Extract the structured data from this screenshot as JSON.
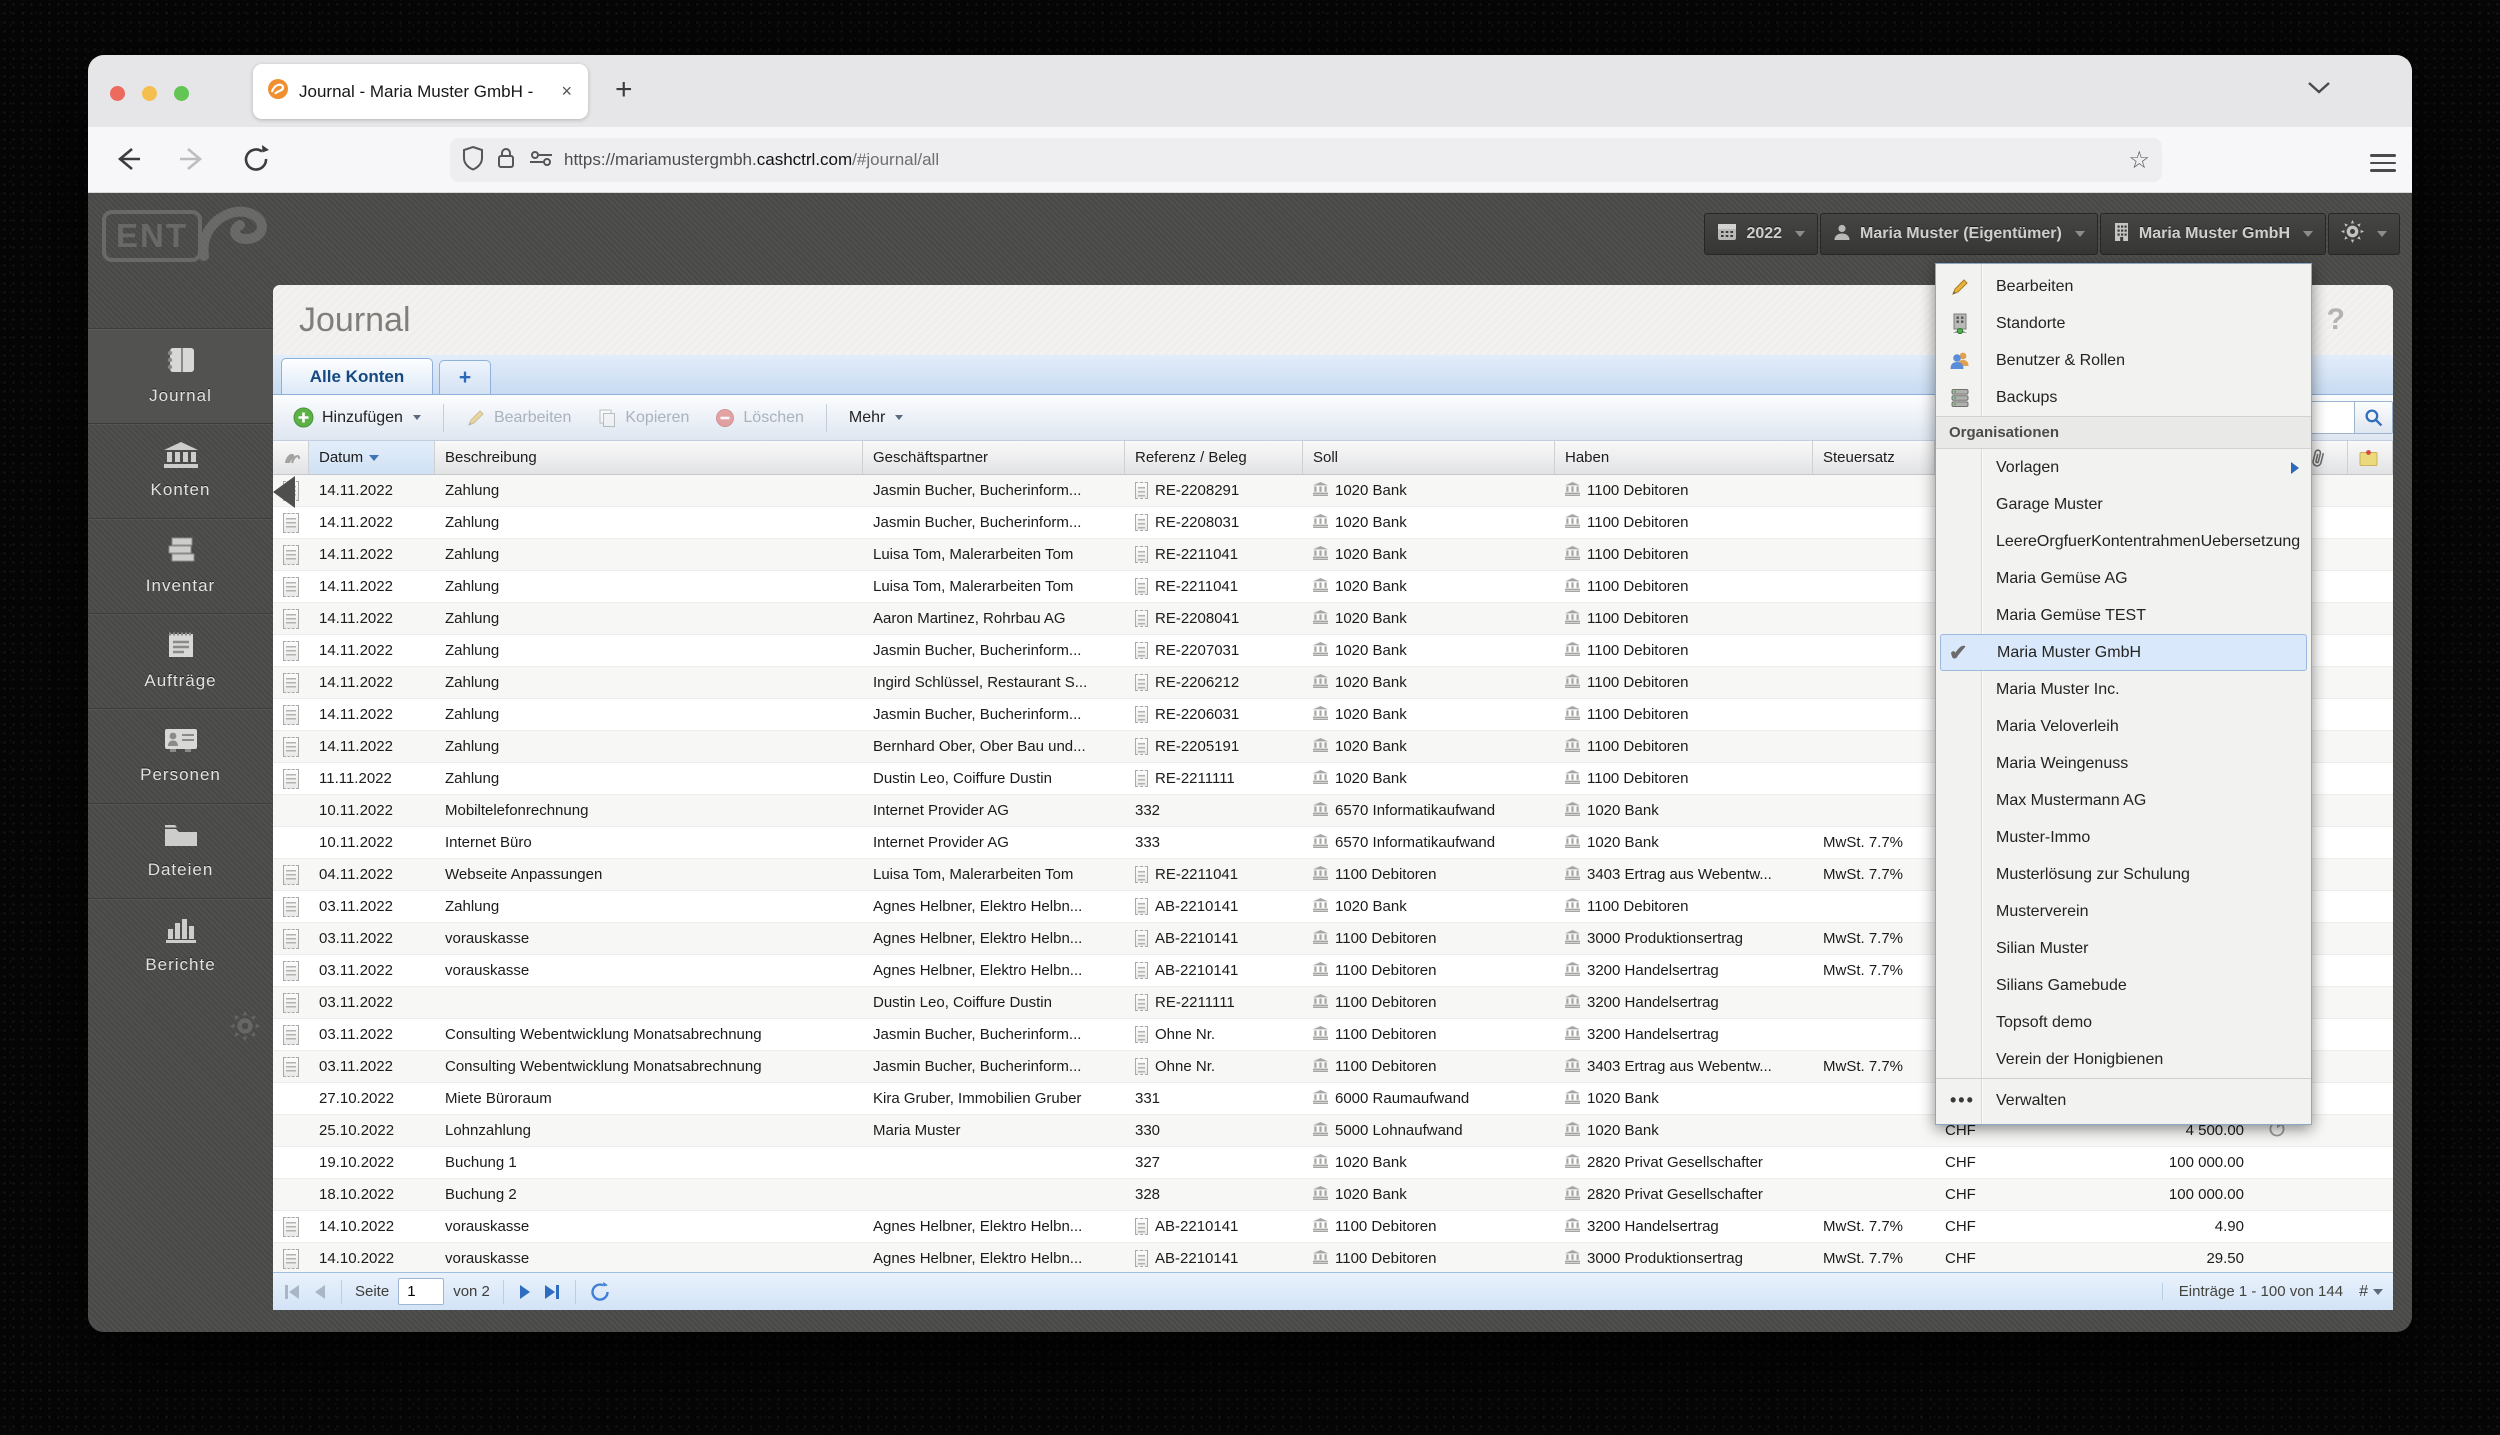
{
  "browser": {
    "tab_title": "Journal - Maria Muster GmbH -",
    "close_glyph": "×",
    "new_tab_glyph": "+",
    "url_scheme": "https://mariamustergmbh.",
    "url_domain": "cashctrl.com",
    "url_path": "/#journal/all",
    "star_glyph": "☆"
  },
  "app_header": {
    "year": "2022",
    "user": "Maria Muster (Eigentümer)",
    "org": "Maria Muster GmbH"
  },
  "sidebar": {
    "logo": "ENT",
    "items": [
      {
        "label": "Journal",
        "icon": "journal-icon",
        "active": true
      },
      {
        "label": "Konten",
        "icon": "accounts-icon",
        "active": false
      },
      {
        "label": "Inventar",
        "icon": "inventory-icon",
        "active": false
      },
      {
        "label": "Aufträge",
        "icon": "orders-icon",
        "active": false
      },
      {
        "label": "Personen",
        "icon": "people-icon",
        "active": false
      },
      {
        "label": "Dateien",
        "icon": "files-icon",
        "active": false
      },
      {
        "label": "Berichte",
        "icon": "reports-icon",
        "active": false
      }
    ]
  },
  "page": {
    "title": "Journal",
    "help_glyph": "?"
  },
  "tabs": {
    "active": "Alle Konten",
    "add_glyph": "+"
  },
  "toolbar": {
    "add": "Hinzufügen",
    "edit": "Bearbeiten",
    "copy": "Kopieren",
    "delete": "Löschen",
    "more": "Mehr"
  },
  "table": {
    "columns": {
      "date": "Datum",
      "description": "Beschreibung",
      "partner": "Geschäftspartner",
      "reference": "Referenz / Beleg",
      "debit": "Soll",
      "credit": "Haben",
      "tax": "Steuersatz"
    },
    "rows": [
      {
        "doc": true,
        "date": "14.11.2022",
        "desc": "Zahlung",
        "partner": "Jasmin Bucher, Bucherinform...",
        "ref": "RE-2208291",
        "refIcon": true,
        "debit": "1020 Bank",
        "credit": "1100 Debitoren",
        "tax": "",
        "cur": "",
        "amt": "",
        "rec": false
      },
      {
        "doc": true,
        "date": "14.11.2022",
        "desc": "Zahlung",
        "partner": "Jasmin Bucher, Bucherinform...",
        "ref": "RE-2208031",
        "refIcon": true,
        "debit": "1020 Bank",
        "credit": "1100 Debitoren",
        "tax": "",
        "cur": "",
        "amt": "",
        "rec": false
      },
      {
        "doc": true,
        "date": "14.11.2022",
        "desc": "Zahlung",
        "partner": "Luisa Tom, Malerarbeiten Tom",
        "ref": "RE-2211041",
        "refIcon": true,
        "debit": "1020 Bank",
        "credit": "1100 Debitoren",
        "tax": "",
        "cur": "",
        "amt": "",
        "rec": false
      },
      {
        "doc": true,
        "date": "14.11.2022",
        "desc": "Zahlung",
        "partner": "Luisa Tom, Malerarbeiten Tom",
        "ref": "RE-2211041",
        "refIcon": true,
        "debit": "1020 Bank",
        "credit": "1100 Debitoren",
        "tax": "",
        "cur": "",
        "amt": "",
        "rec": false
      },
      {
        "doc": true,
        "date": "14.11.2022",
        "desc": "Zahlung",
        "partner": "Aaron Martinez, Rohrbau AG",
        "ref": "RE-2208041",
        "refIcon": true,
        "debit": "1020 Bank",
        "credit": "1100 Debitoren",
        "tax": "",
        "cur": "",
        "amt": "",
        "rec": false
      },
      {
        "doc": true,
        "date": "14.11.2022",
        "desc": "Zahlung",
        "partner": "Jasmin Bucher, Bucherinform...",
        "ref": "RE-2207031",
        "refIcon": true,
        "debit": "1020 Bank",
        "credit": "1100 Debitoren",
        "tax": "",
        "cur": "",
        "amt": "",
        "rec": false
      },
      {
        "doc": true,
        "date": "14.11.2022",
        "desc": "Zahlung",
        "partner": "Ingird Schlüssel, Restaurant S...",
        "ref": "RE-2206212",
        "refIcon": true,
        "debit": "1020 Bank",
        "credit": "1100 Debitoren",
        "tax": "",
        "cur": "",
        "amt": "",
        "rec": false
      },
      {
        "doc": true,
        "date": "14.11.2022",
        "desc": "Zahlung",
        "partner": "Jasmin Bucher, Bucherinform...",
        "ref": "RE-2206031",
        "refIcon": true,
        "debit": "1020 Bank",
        "credit": "1100 Debitoren",
        "tax": "",
        "cur": "",
        "amt": "",
        "rec": false
      },
      {
        "doc": true,
        "date": "14.11.2022",
        "desc": "Zahlung",
        "partner": "Bernhard Ober, Ober Bau und...",
        "ref": "RE-2205191",
        "refIcon": true,
        "debit": "1020 Bank",
        "credit": "1100 Debitoren",
        "tax": "",
        "cur": "",
        "amt": "",
        "rec": false
      },
      {
        "doc": true,
        "date": "11.11.2022",
        "desc": "Zahlung",
        "partner": "Dustin Leo, Coiffure Dustin",
        "ref": "RE-2211111",
        "refIcon": true,
        "debit": "1020 Bank",
        "credit": "1100 Debitoren",
        "tax": "",
        "cur": "",
        "amt": "",
        "rec": false
      },
      {
        "doc": false,
        "date": "10.11.2022",
        "desc": "Mobiltelefonrechnung",
        "partner": "Internet Provider AG",
        "ref": "332",
        "refIcon": false,
        "debit": "6570 Informatikaufwand",
        "credit": "1020 Bank",
        "tax": "",
        "cur": "",
        "amt": "",
        "rec": false
      },
      {
        "doc": false,
        "date": "10.11.2022",
        "desc": "Internet Büro",
        "partner": "Internet Provider AG",
        "ref": "333",
        "refIcon": false,
        "debit": "6570 Informatikaufwand",
        "credit": "1020 Bank",
        "tax": "MwSt. 7.7%",
        "cur": "",
        "amt": "",
        "rec": false
      },
      {
        "doc": true,
        "date": "04.11.2022",
        "desc": "Webseite Anpassungen",
        "partner": "Luisa Tom, Malerarbeiten Tom",
        "ref": "RE-2211041",
        "refIcon": true,
        "debit": "1100 Debitoren",
        "credit": "3403 Ertrag aus Webentw...",
        "tax": "MwSt. 7.7%",
        "cur": "",
        "amt": "",
        "rec": false
      },
      {
        "doc": true,
        "date": "03.11.2022",
        "desc": "Zahlung",
        "partner": "Agnes Helbner, Elektro Helbn...",
        "ref": "AB-2210141",
        "refIcon": true,
        "debit": "1020 Bank",
        "credit": "1100 Debitoren",
        "tax": "",
        "cur": "",
        "amt": "",
        "rec": false
      },
      {
        "doc": true,
        "date": "03.11.2022",
        "desc": "vorauskasse",
        "partner": "Agnes Helbner, Elektro Helbn...",
        "ref": "AB-2210141",
        "refIcon": true,
        "debit": "1100 Debitoren",
        "credit": "3000 Produktionsertrag",
        "tax": "MwSt. 7.7%",
        "cur": "",
        "amt": "",
        "rec": false
      },
      {
        "doc": true,
        "date": "03.11.2022",
        "desc": "vorauskasse",
        "partner": "Agnes Helbner, Elektro Helbn...",
        "ref": "AB-2210141",
        "refIcon": true,
        "debit": "1100 Debitoren",
        "credit": "3200 Handelsertrag",
        "tax": "MwSt. 7.7%",
        "cur": "",
        "amt": "",
        "rec": false
      },
      {
        "doc": true,
        "date": "03.11.2022",
        "desc": "",
        "partner": "Dustin Leo, Coiffure Dustin",
        "ref": "RE-2211111",
        "refIcon": true,
        "debit": "1100 Debitoren",
        "credit": "3200 Handelsertrag",
        "tax": "",
        "cur": "",
        "amt": "",
        "rec": false
      },
      {
        "doc": true,
        "date": "03.11.2022",
        "desc": "Consulting Webentwicklung Monatsabrechnung",
        "partner": "Jasmin Bucher, Bucherinform...",
        "ref": "Ohne Nr.",
        "refIcon": true,
        "debit": "1100 Debitoren",
        "credit": "3200 Handelsertrag",
        "tax": "",
        "cur": "",
        "amt": "",
        "rec": false
      },
      {
        "doc": true,
        "date": "03.11.2022",
        "desc": "Consulting Webentwicklung Monatsabrechnung",
        "partner": "Jasmin Bucher, Bucherinform...",
        "ref": "Ohne Nr.",
        "refIcon": true,
        "debit": "1100 Debitoren",
        "credit": "3403 Ertrag aus Webentw...",
        "tax": "MwSt. 7.7%",
        "cur": "",
        "amt": "",
        "rec": false
      },
      {
        "doc": false,
        "date": "27.10.2022",
        "desc": "Miete Büroraum",
        "partner": "Kira Gruber, Immobilien Gruber",
        "ref": "331",
        "refIcon": false,
        "debit": "6000 Raumaufwand",
        "credit": "1020 Bank",
        "tax": "",
        "cur": "",
        "amt": "",
        "rec": false
      },
      {
        "doc": false,
        "date": "25.10.2022",
        "desc": "Lohnzahlung",
        "partner": "Maria Muster",
        "ref": "330",
        "refIcon": false,
        "debit": "5000 Lohnaufwand",
        "credit": "1020 Bank",
        "tax": "",
        "cur": "CHF",
        "amt": "4 500.00",
        "rec": true
      },
      {
        "doc": false,
        "date": "19.10.2022",
        "desc": "Buchung 1",
        "partner": "",
        "ref": "327",
        "refIcon": false,
        "debit": "1020 Bank",
        "credit": "2820 Privat Gesellschafter",
        "tax": "",
        "cur": "CHF",
        "amt": "100 000.00",
        "rec": false
      },
      {
        "doc": false,
        "date": "18.10.2022",
        "desc": "Buchung 2",
        "partner": "",
        "ref": "328",
        "refIcon": false,
        "debit": "1020 Bank",
        "credit": "2820 Privat Gesellschafter",
        "tax": "",
        "cur": "CHF",
        "amt": "100 000.00",
        "rec": false
      },
      {
        "doc": true,
        "date": "14.10.2022",
        "desc": "vorauskasse",
        "partner": "Agnes Helbner, Elektro Helbn...",
        "ref": "AB-2210141",
        "refIcon": true,
        "debit": "1100 Debitoren",
        "credit": "3200 Handelsertrag",
        "tax": "MwSt. 7.7%",
        "cur": "CHF",
        "amt": "4.90",
        "rec": false
      },
      {
        "doc": true,
        "date": "14.10.2022",
        "desc": "vorauskasse",
        "partner": "Agnes Helbner, Elektro Helbn...",
        "ref": "AB-2210141",
        "refIcon": true,
        "debit": "1100 Debitoren",
        "credit": "3000 Produktionsertrag",
        "tax": "MwSt. 7.7%",
        "cur": "CHF",
        "amt": "29.50",
        "rec": false
      }
    ]
  },
  "org_menu": {
    "actions": [
      {
        "label": "Bearbeiten",
        "icon": "pencil-icon"
      },
      {
        "label": "Standorte",
        "icon": "locations-icon"
      },
      {
        "label": "Benutzer & Rollen",
        "icon": "users-icon"
      },
      {
        "label": "Backups",
        "icon": "backups-icon"
      }
    ],
    "section_label": "Organisationen",
    "orgs": [
      {
        "label": "Vorlagen",
        "submenu": true,
        "selected": false
      },
      {
        "label": "Garage Muster",
        "submenu": false,
        "selected": false
      },
      {
        "label": "LeereOrgfuerKontentrahmenUebersetzung",
        "submenu": false,
        "selected": false
      },
      {
        "label": "Maria Gemüse AG",
        "submenu": false,
        "selected": false
      },
      {
        "label": "Maria Gemüse TEST",
        "submenu": false,
        "selected": false
      },
      {
        "label": "Maria Muster GmbH",
        "submenu": false,
        "selected": true
      },
      {
        "label": "Maria Muster Inc.",
        "submenu": false,
        "selected": false
      },
      {
        "label": "Maria Veloverleih",
        "submenu": false,
        "selected": false
      },
      {
        "label": "Maria Weingenuss",
        "submenu": false,
        "selected": false
      },
      {
        "label": "Max Mustermann AG",
        "submenu": false,
        "selected": false
      },
      {
        "label": "Muster-Immo",
        "submenu": false,
        "selected": false
      },
      {
        "label": "Musterlösung zur Schulung",
        "submenu": false,
        "selected": false
      },
      {
        "label": "Musterverein",
        "submenu": false,
        "selected": false
      },
      {
        "label": "Silian Muster",
        "submenu": false,
        "selected": false
      },
      {
        "label": "Silians Gamebude",
        "submenu": false,
        "selected": false
      },
      {
        "label": "Topsoft demo",
        "submenu": false,
        "selected": false
      },
      {
        "label": "Verein der Honigbienen",
        "submenu": false,
        "selected": false
      }
    ],
    "manage": "Verwalten",
    "check_glyph": "✔",
    "dots_glyph": "•••"
  },
  "pagination": {
    "page_label": "Seite",
    "page_value": "1",
    "of_label": "von 2",
    "entries": "Einträge 1 - 100 von 144",
    "count_symbol": "#"
  },
  "colors": {
    "accent_blue": "#2a6ab8",
    "tab_text": "#15497f",
    "add_green": "#5cb245",
    "delete_red": "#d9534f",
    "sticky_yellow": "#ecd97c",
    "selected_row_bg": "#d9e8fb"
  }
}
